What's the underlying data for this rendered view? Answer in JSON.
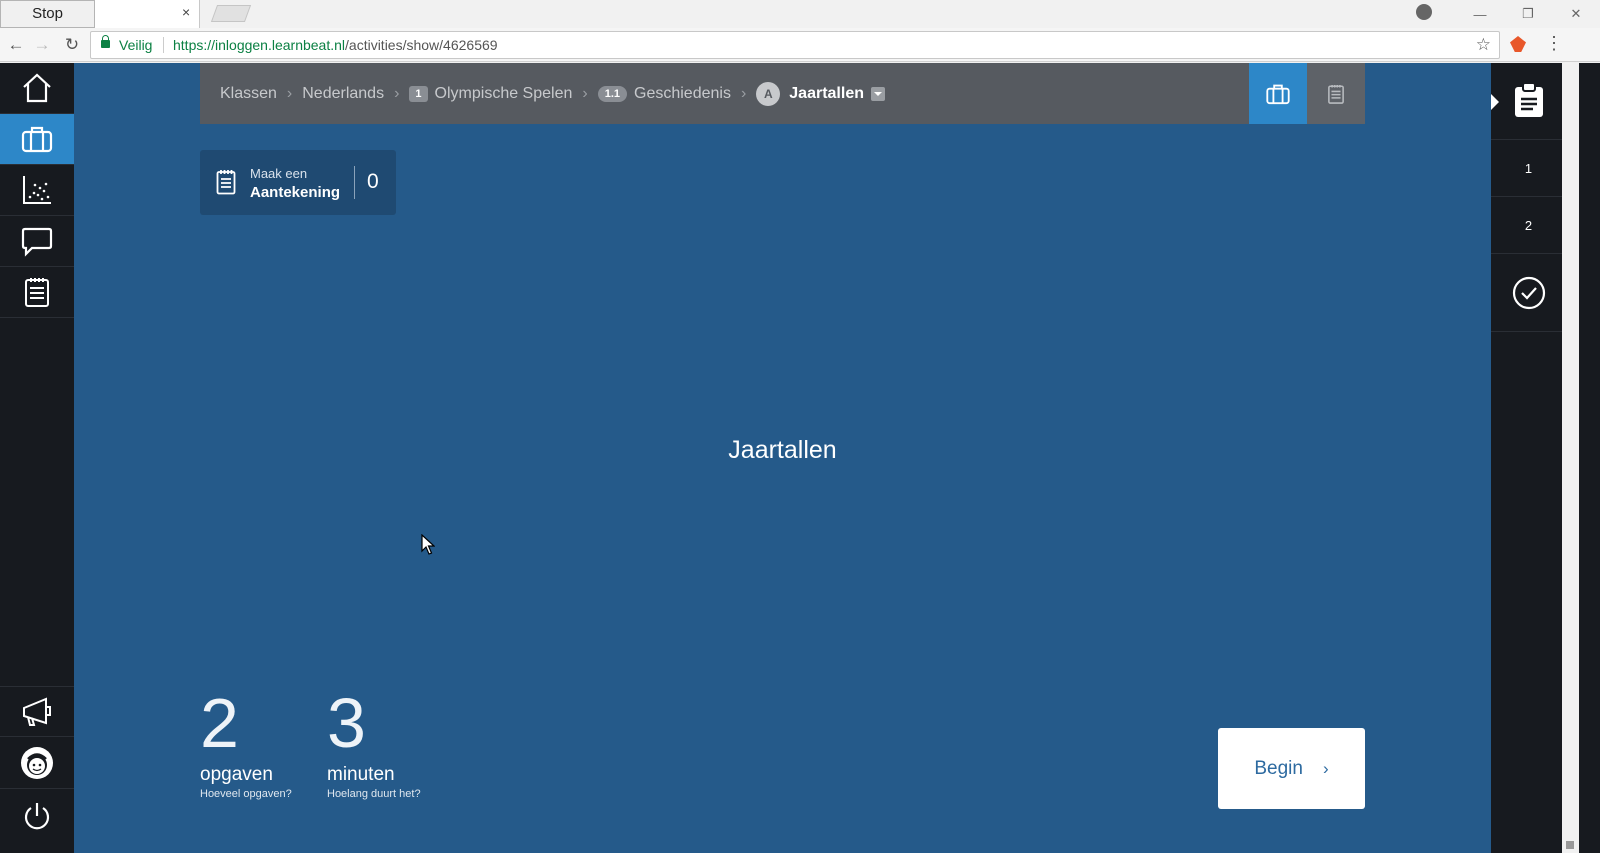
{
  "browser": {
    "tab_title": "Stop",
    "tab_close": "×",
    "secure_label": "Veilig",
    "url_host": "https://inloggen.learnbeat.nl",
    "url_path": "/activities/show/4626569",
    "back_icon": "←",
    "forward_icon": "→",
    "reload_icon": "↻",
    "star_icon": "☆",
    "menu_icon": "⋮",
    "window_controls": [
      "—",
      "❐",
      "✕"
    ]
  },
  "sidebar": {
    "items": [
      "home-icon",
      "briefcase-icon",
      "chart-icon",
      "chat-icon",
      "notes-icon",
      "megaphone-icon",
      "avatar",
      "power-icon"
    ],
    "active": "briefcase-icon",
    "active_color": "#2d87c8"
  },
  "breadcrumb": {
    "items": [
      {
        "label": "Klassen"
      },
      {
        "label": "Nederlands"
      },
      {
        "badge": "1",
        "label": "Olympische Spelen"
      },
      {
        "badge": "1.1",
        "label": "Geschiedenis"
      }
    ],
    "current_badge": "A",
    "current": "Jaartallen",
    "chevron": "›"
  },
  "note": {
    "line1": "Maak een",
    "line2": "Aantekening",
    "count": "0"
  },
  "activity": {
    "title": "Jaartallen"
  },
  "stats": [
    {
      "value": "2",
      "label": "opgaven",
      "sub": "Hoeveel opgaven?"
    },
    {
      "value": "3",
      "label": "minuten",
      "sub": "Hoelang duurt het?"
    }
  ],
  "begin": {
    "label": "Begin",
    "chevron": "›"
  },
  "right_panel": {
    "items": [
      {
        "label": "1",
        "color": "#6ab344"
      },
      {
        "label": "2",
        "color": "#2d87c8"
      }
    ]
  },
  "colors": {
    "main_bg": "#255a8a",
    "sidebar_bg": "#171a1f",
    "breadcrumb_bg": "#565a60"
  }
}
